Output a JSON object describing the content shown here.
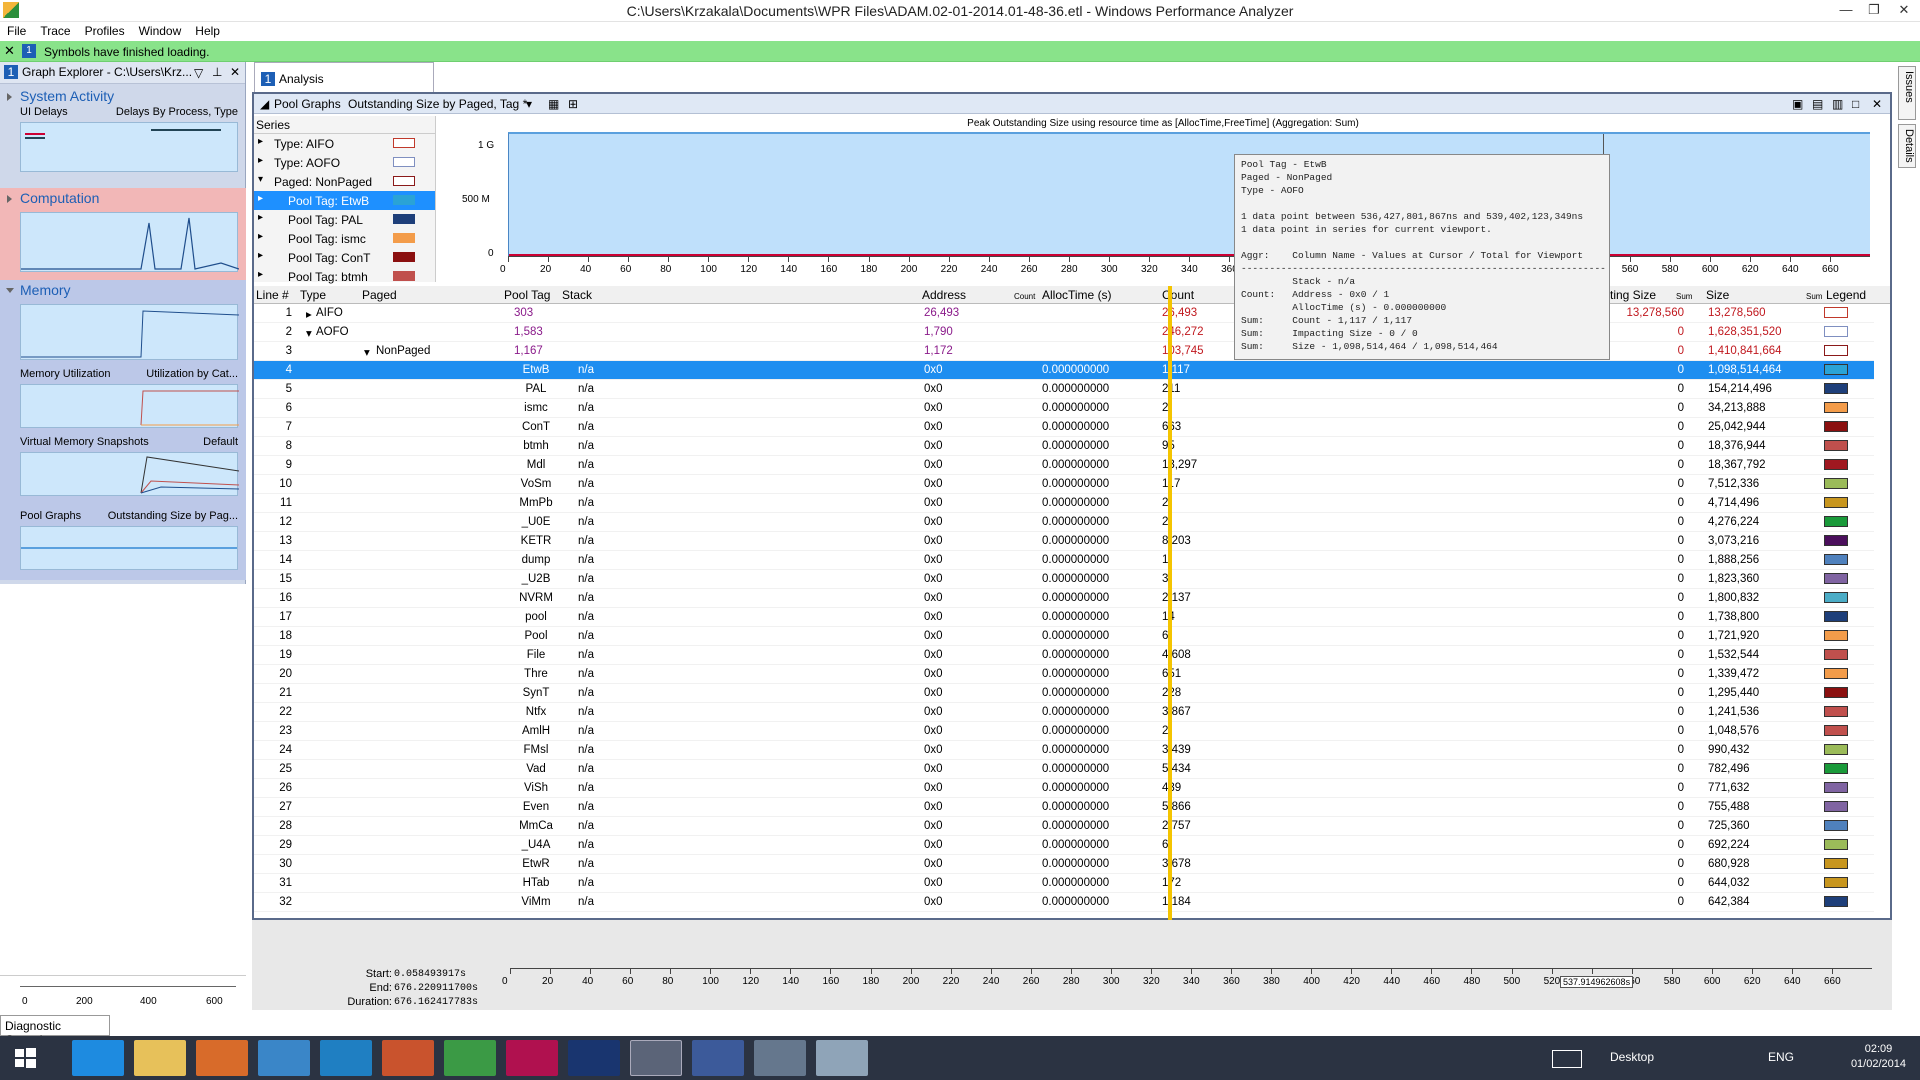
{
  "window": {
    "title": "C:\\Users\\Krzakala\\Documents\\WPR Files\\ADAM.02-01-2014.01-48-36.etl - Windows Performance Analyzer"
  },
  "menu": [
    "File",
    "Trace",
    "Profiles",
    "Window",
    "Help"
  ],
  "notification": {
    "badge": "1",
    "message": "Symbols have finished loading."
  },
  "graph_explorer": {
    "number": "1",
    "title": "Graph Explorer - C:\\Users\\Krz...",
    "categories": [
      {
        "name": "System Activity",
        "thumbs": [
          {
            "left": "UI Delays",
            "right": "Delays By Process, Type"
          }
        ]
      },
      {
        "name": "Computation",
        "thumbs": []
      },
      {
        "name": "Memory",
        "thumbs": [
          {
            "left": "Memory Utilization",
            "right": "Utilization by Cat..."
          },
          {
            "left": "Virtual Memory Snapshots",
            "right": "Default"
          },
          {
            "left": "Pool Graphs",
            "right": "Outstanding Size by Pag..."
          }
        ]
      }
    ],
    "timeline_ticks": [
      "0",
      "200",
      "400",
      "600"
    ],
    "diagnostic_console": "Diagnostic Console"
  },
  "analysis": {
    "tab_number": "1",
    "tab_label": "Analysis",
    "toolbar": {
      "graph": "Pool Graphs",
      "preset": "Outstanding Size by Paged, Tag *"
    },
    "chart_title": "Peak Outstanding Size using resource time as [AllocTime,FreeTime] (Aggregation: Sum)",
    "series_header": "Series",
    "series": [
      {
        "label": "Type: AIFO",
        "color": "#ffffff",
        "border": "#c0392b"
      },
      {
        "label": "Type: AOFO",
        "color": "#ffffff",
        "border": "#7f8fc0"
      },
      {
        "label": "Paged: NonPaged",
        "color": "#ffffff",
        "border": "#8b1a1a"
      },
      {
        "label": "Pool Tag: EtwB",
        "color": "#2aa3d6",
        "border": "#2aa3d6"
      },
      {
        "label": "Pool Tag: PAL",
        "color": "#1e3f7a",
        "border": "#1e3f7a"
      },
      {
        "label": "Pool Tag: ismc",
        "color": "#f39c4a",
        "border": "#f39c4a"
      },
      {
        "label": "Pool Tag: ConT",
        "color": "#8b1010",
        "border": "#8b1010"
      },
      {
        "label": "Pool Tag: btmh",
        "color": "#c0504d",
        "border": "#c0504d"
      }
    ],
    "tooltip": "Pool Tag - EtwB\nPaged - NonPaged\nType - AOFO\n\n1 data point between 536,427,801,867ns and 539,402,123,349ns\n1 data point in series for current viewport.\n\nAggr:    Column Name - Values at Cursor / Total for Viewport\n----------------------------------------------------------------\n         Stack - n/a\nCount:   Address - 0x0 / 1\n         AllocTime (s) - 0.000000000\nSum:     Count - 1,117 / 1,117\nSum:     Impacting Size - 0 / 0\nSum:     Size - 1,098,514,464 / 1,098,514,464",
    "columns": [
      "Line #",
      "Type",
      "Paged",
      "Pool Tag",
      "Stack",
      "Address",
      "AllocTime (s)",
      "Count",
      "cting Size",
      "Size",
      "Legend"
    ],
    "column_sub": {
      "address": "Count",
      "impacting": "Sum",
      "size": "Sum"
    },
    "group_rows": [
      {
        "line": "1",
        "type": "AIFO",
        "paged": "",
        "tag": "303",
        "address": "26,493",
        "count": "26,493",
        "impacting": "13,278,560",
        "size": "13,278,560"
      },
      {
        "line": "2",
        "type": "AOFO",
        "paged": "",
        "tag": "1,583",
        "address": "1,790",
        "count": "246,272",
        "impacting": "0",
        "size": "1,628,351,520"
      },
      {
        "line": "3",
        "type": "",
        "paged": "NonPaged",
        "tag": "1,167",
        "address": "1,172",
        "count": "103,745",
        "impacting": "0",
        "size": "1,410,841,664"
      }
    ],
    "rows": [
      {
        "line": "4",
        "tag": "EtwB",
        "stack": "n/a",
        "address": "0x0",
        "alloc": "0.000000000",
        "count": "1,117",
        "impacting": "0",
        "size": "1,098,514,464",
        "color": "#2aa3d6"
      },
      {
        "line": "5",
        "tag": "PAL",
        "stack": "n/a",
        "address": "0x0",
        "alloc": "0.000000000",
        "count": "211",
        "impacting": "0",
        "size": "154,214,496",
        "color": "#1e3f7a"
      },
      {
        "line": "6",
        "tag": "ismc",
        "stack": "n/a",
        "address": "0x0",
        "alloc": "0.000000000",
        "count": "2",
        "impacting": "0",
        "size": "34,213,888",
        "color": "#f39c4a"
      },
      {
        "line": "7",
        "tag": "ConT",
        "stack": "n/a",
        "address": "0x0",
        "alloc": "0.000000000",
        "count": "663",
        "impacting": "0",
        "size": "25,042,944",
        "color": "#8b1010"
      },
      {
        "line": "8",
        "tag": "btmh",
        "stack": "n/a",
        "address": "0x0",
        "alloc": "0.000000000",
        "count": "95",
        "impacting": "0",
        "size": "18,376,944",
        "color": "#c0504d"
      },
      {
        "line": "9",
        "tag": "Mdl",
        "stack": "n/a",
        "address": "0x0",
        "alloc": "0.000000000",
        "count": "13,297",
        "impacting": "0",
        "size": "18,367,792",
        "color": "#a01820"
      },
      {
        "line": "10",
        "tag": "VoSm",
        "stack": "n/a",
        "address": "0x0",
        "alloc": "0.000000000",
        "count": "117",
        "impacting": "0",
        "size": "7,512,336",
        "color": "#9bbb59"
      },
      {
        "line": "11",
        "tag": "MmPb",
        "stack": "n/a",
        "address": "0x0",
        "alloc": "0.000000000",
        "count": "2",
        "impacting": "0",
        "size": "4,714,496",
        "color": "#c8961e"
      },
      {
        "line": "12",
        "tag": "_U0E",
        "stack": "n/a",
        "address": "0x0",
        "alloc": "0.000000000",
        "count": "2",
        "impacting": "0",
        "size": "4,276,224",
        "color": "#1a9a3a"
      },
      {
        "line": "13",
        "tag": "KETR",
        "stack": "n/a",
        "address": "0x0",
        "alloc": "0.000000000",
        "count": "8,203",
        "impacting": "0",
        "size": "3,073,216",
        "color": "#4b0f5c"
      },
      {
        "line": "14",
        "tag": "dump",
        "stack": "n/a",
        "address": "0x0",
        "alloc": "0.000000000",
        "count": "1",
        "impacting": "0",
        "size": "1,888,256",
        "color": "#4f81bd"
      },
      {
        "line": "15",
        "tag": "_U2B",
        "stack": "n/a",
        "address": "0x0",
        "alloc": "0.000000000",
        "count": "3",
        "impacting": "0",
        "size": "1,823,360",
        "color": "#8064a2"
      },
      {
        "line": "16",
        "tag": "NVRM",
        "stack": "n/a",
        "address": "0x0",
        "alloc": "0.000000000",
        "count": "2,137",
        "impacting": "0",
        "size": "1,800,832",
        "color": "#4bacc6"
      },
      {
        "line": "17",
        "tag": "pool",
        "stack": "n/a",
        "address": "0x0",
        "alloc": "0.000000000",
        "count": "14",
        "impacting": "0",
        "size": "1,738,800",
        "color": "#1e3f7a"
      },
      {
        "line": "18",
        "tag": "Pool",
        "stack": "n/a",
        "address": "0x0",
        "alloc": "0.000000000",
        "count": "6",
        "impacting": "0",
        "size": "1,721,920",
        "color": "#f39c4a"
      },
      {
        "line": "19",
        "tag": "File",
        "stack": "n/a",
        "address": "0x0",
        "alloc": "0.000000000",
        "count": "4,608",
        "impacting": "0",
        "size": "1,532,544",
        "color": "#c0504d"
      },
      {
        "line": "20",
        "tag": "Thre",
        "stack": "n/a",
        "address": "0x0",
        "alloc": "0.000000000",
        "count": "651",
        "impacting": "0",
        "size": "1,339,472",
        "color": "#f39c4a"
      },
      {
        "line": "21",
        "tag": "SynT",
        "stack": "n/a",
        "address": "0x0",
        "alloc": "0.000000000",
        "count": "228",
        "impacting": "0",
        "size": "1,295,440",
        "color": "#8b1010"
      },
      {
        "line": "22",
        "tag": "Ntfx",
        "stack": "n/a",
        "address": "0x0",
        "alloc": "0.000000000",
        "count": "3,867",
        "impacting": "0",
        "size": "1,241,536",
        "color": "#c0504d"
      },
      {
        "line": "23",
        "tag": "AmlH",
        "stack": "n/a",
        "address": "0x0",
        "alloc": "0.000000000",
        "count": "2",
        "impacting": "0",
        "size": "1,048,576",
        "color": "#c0504d"
      },
      {
        "line": "24",
        "tag": "FMsl",
        "stack": "n/a",
        "address": "0x0",
        "alloc": "0.000000000",
        "count": "3,439",
        "impacting": "0",
        "size": "990,432",
        "color": "#9bbb59"
      },
      {
        "line": "25",
        "tag": "Vad",
        "stack": "n/a",
        "address": "0x0",
        "alloc": "0.000000000",
        "count": "5,434",
        "impacting": "0",
        "size": "782,496",
        "color": "#1a9a3a"
      },
      {
        "line": "26",
        "tag": "ViSh",
        "stack": "n/a",
        "address": "0x0",
        "alloc": "0.000000000",
        "count": "439",
        "impacting": "0",
        "size": "771,632",
        "color": "#8064a2"
      },
      {
        "line": "27",
        "tag": "Even",
        "stack": "n/a",
        "address": "0x0",
        "alloc": "0.000000000",
        "count": "5,866",
        "impacting": "0",
        "size": "755,488",
        "color": "#8064a2"
      },
      {
        "line": "28",
        "tag": "MmCa",
        "stack": "n/a",
        "address": "0x0",
        "alloc": "0.000000000",
        "count": "2,757",
        "impacting": "0",
        "size": "725,360",
        "color": "#4f81bd"
      },
      {
        "line": "29",
        "tag": "_U4A",
        "stack": "n/a",
        "address": "0x0",
        "alloc": "0.000000000",
        "count": "6",
        "impacting": "0",
        "size": "692,224",
        "color": "#9bbb59"
      },
      {
        "line": "30",
        "tag": "EtwR",
        "stack": "n/a",
        "address": "0x0",
        "alloc": "0.000000000",
        "count": "3,678",
        "impacting": "0",
        "size": "680,928",
        "color": "#c8961e"
      },
      {
        "line": "31",
        "tag": "HTab",
        "stack": "n/a",
        "address": "0x0",
        "alloc": "0.000000000",
        "count": "172",
        "impacting": "0",
        "size": "644,032",
        "color": "#c8961e"
      },
      {
        "line": "32",
        "tag": "ViMm",
        "stack": "n/a",
        "address": "0x0",
        "alloc": "0.000000000",
        "count": "1,184",
        "impacting": "0",
        "size": "642,384",
        "color": "#1e3f7a"
      }
    ],
    "time": {
      "start_label": "Start:",
      "start": "0.058493917s",
      "end_label": "End:",
      "end": "676.220911700s",
      "duration_label": "Duration:",
      "duration": "676.162417783s",
      "cursor": "537.914962608s"
    },
    "axis_ticks": [
      "0",
      "20",
      "40",
      "60",
      "80",
      "100",
      "120",
      "140",
      "160",
      "180",
      "200",
      "220",
      "240",
      "260",
      "280",
      "300",
      "320",
      "340",
      "360",
      "380",
      "400",
      "420",
      "440",
      "460",
      "480",
      "500",
      "520",
      "540",
      "560",
      "580",
      "600",
      "620",
      "640",
      "660"
    ],
    "y_ticks": [
      "1 G",
      "500 M",
      "0"
    ]
  },
  "side_tabs": [
    "Issues",
    "Details"
  ],
  "taskbar": {
    "desktop": "Desktop",
    "lang": "ENG",
    "time": "02:09",
    "date": "01/02/2014"
  }
}
